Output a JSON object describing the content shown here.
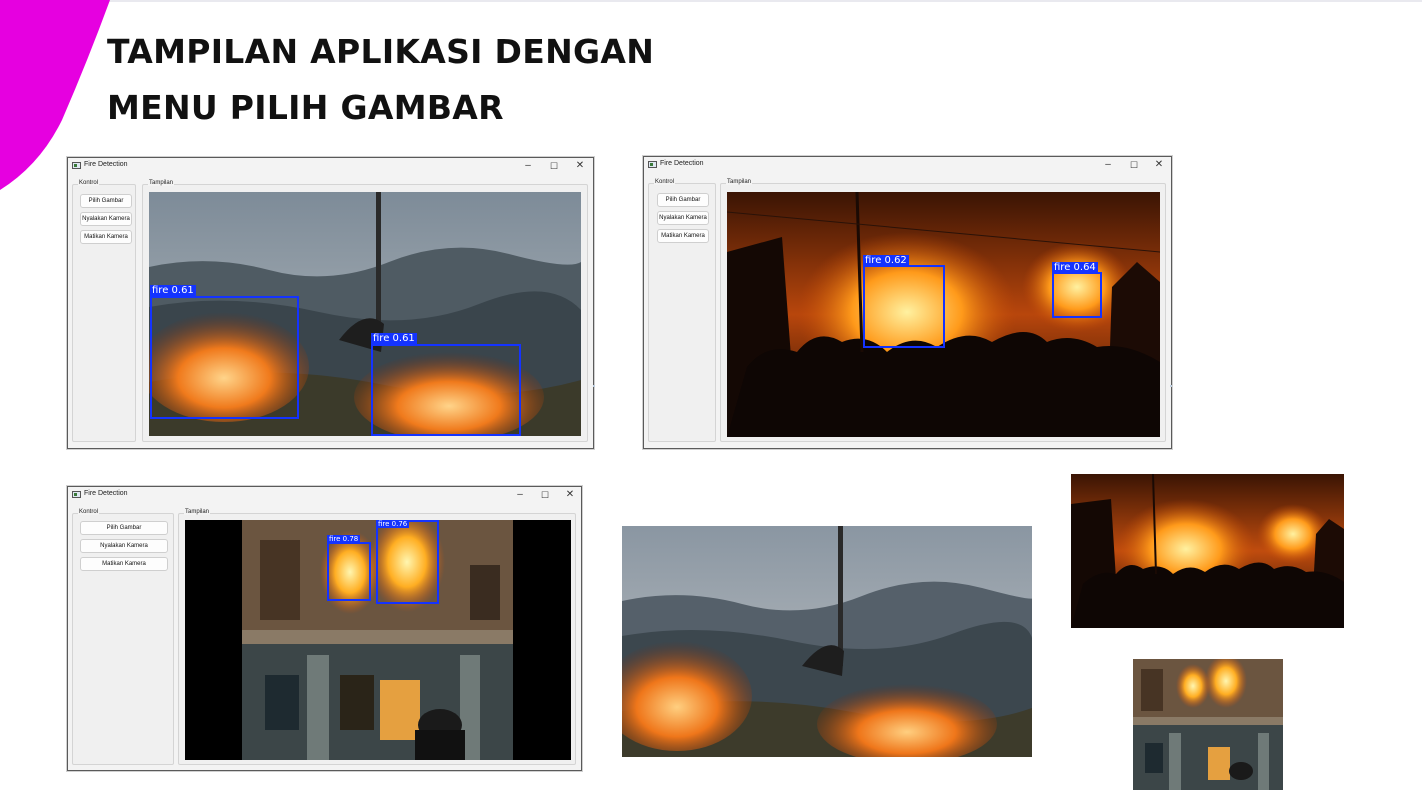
{
  "slide": {
    "title_line1": "TAMPILAN APLIKASI DENGAN",
    "title_line2": "MENU PILIH GAMBAR",
    "accent_color": "#e600e0"
  },
  "app": {
    "window_title": "Fire Detection",
    "minimize_icon": "–",
    "maximize_icon": "☐",
    "close_icon": "✕",
    "control_group_label": "Kontrol",
    "display_group_label": "Tampilan",
    "buttons": {
      "choose_image": "Pilih Gambar",
      "camera_on": "Nyalakan Kamera",
      "camera_off": "Matikan Kamera"
    },
    "box_color": "#1433ff"
  },
  "windows": [
    {
      "detections": [
        {
          "label": "fire 0.61"
        },
        {
          "label": "fire 0.61"
        }
      ]
    },
    {
      "detections": [
        {
          "label": "fire 0.62"
        },
        {
          "label": "fire 0.64"
        }
      ]
    },
    {
      "detections": [
        {
          "label": "fire 0.78"
        },
        {
          "label": "fire 0.76"
        }
      ]
    }
  ]
}
